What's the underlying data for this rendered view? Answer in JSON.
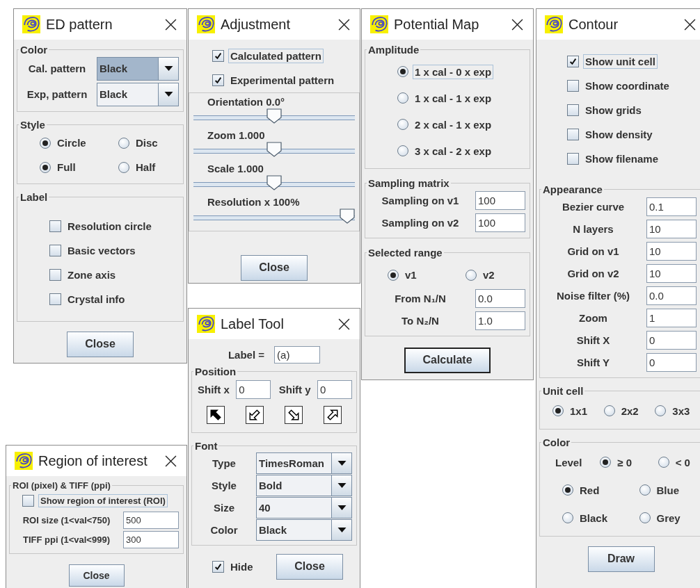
{
  "windows": [
    {
      "title": "ED pattern",
      "sections": [
        {
          "framed": true,
          "title": "Color",
          "rows": [
            {
              "kind": "combo",
              "label": "Cal. pattern",
              "value": "Black",
              "highlighted": true
            },
            {
              "kind": "combo",
              "label": "Exp, pattern",
              "value": "Black",
              "highlighted": false
            }
          ]
        },
        {
          "framed": true,
          "title": "Style",
          "rows": [
            {
              "kind": "radios",
              "options": [
                {
                  "label": "Circle",
                  "selected": true,
                  "focused": false
                },
                {
                  "label": "Disc",
                  "selected": false,
                  "focused": false
                }
              ]
            },
            {
              "kind": "radios",
              "options": [
                {
                  "label": "Full",
                  "selected": true,
                  "focused": false
                },
                {
                  "label": "Half",
                  "selected": false,
                  "focused": false
                }
              ]
            }
          ]
        },
        {
          "framed": true,
          "title": "Label",
          "rows": [
            {
              "kind": "checkbox",
              "label": "Resolution circle",
              "checked": false,
              "focused": false
            },
            {
              "kind": "checkbox",
              "label": "Basic vectors",
              "checked": false,
              "focused": false
            },
            {
              "kind": "checkbox",
              "label": "Zone axis",
              "checked": false,
              "focused": false
            },
            {
              "kind": "checkbox",
              "label": "Crystal info",
              "checked": false,
              "focused": false
            }
          ]
        },
        {
          "framed": false,
          "rows": [
            {
              "kind": "button",
              "label": "Close",
              "default": false
            }
          ]
        }
      ]
    },
    {
      "title": "Adjustment",
      "sections": [
        {
          "framed": false,
          "rows": [
            {
              "kind": "checkbox",
              "label": "Calculated pattern",
              "checked": true,
              "focused": true
            },
            {
              "kind": "checkbox",
              "label": "Experimental pattern",
              "checked": true,
              "focused": false
            }
          ]
        },
        {
          "framed": true,
          "rows": [
            {
              "kind": "slider",
              "label": "Orientation 0.0°",
              "level": 0.5
            },
            {
              "kind": "slider",
              "label": "Zoom 1.000",
              "level": 0.5
            },
            {
              "kind": "slider",
              "label": "Scale 1.000",
              "level": 0.5
            },
            {
              "kind": "slider",
              "label": "Resolution x 100%",
              "level": 1.0
            }
          ]
        },
        {
          "framed": false,
          "rows": [
            {
              "kind": "button",
              "label": "Close",
              "default": false
            }
          ]
        }
      ]
    },
    {
      "title": "Potential Map",
      "sections": [
        {
          "framed": true,
          "title": "Amplitude",
          "rows": [
            {
              "kind": "radios",
              "options": [
                {
                  "label": "1 x cal - 0 x exp",
                  "selected": true,
                  "focused": true
                }
              ]
            },
            {
              "kind": "radios",
              "options": [
                {
                  "label": "1 x cal - 1 x exp",
                  "selected": false,
                  "focused": false
                }
              ]
            },
            {
              "kind": "radios",
              "options": [
                {
                  "label": "2 x cal - 1 x exp",
                  "selected": false,
                  "focused": false
                }
              ]
            },
            {
              "kind": "radios",
              "options": [
                {
                  "label": "3 x cal - 2 x exp",
                  "selected": false,
                  "focused": false
                }
              ]
            }
          ]
        },
        {
          "framed": true,
          "title": "Sampling matrix",
          "rows": [
            {
              "kind": "field",
              "label": "Sampling on v1",
              "value": "100"
            },
            {
              "kind": "field",
              "label": "Sampling on v2",
              "value": "100"
            }
          ]
        },
        {
          "framed": true,
          "title": "Selected range",
          "rows": [
            {
              "kind": "radios",
              "options": [
                {
                  "label": "v1",
                  "selected": true,
                  "focused": false
                },
                {
                  "label": "v2",
                  "selected": false,
                  "focused": false
                }
              ]
            },
            {
              "kind": "field",
              "label": "From N₁/N",
              "value": "0.0"
            },
            {
              "kind": "field",
              "label": "To N₂/N",
              "value": "1.0"
            }
          ]
        },
        {
          "framed": false,
          "rows": [
            {
              "kind": "button",
              "label": "Calculate",
              "default": true
            }
          ]
        }
      ]
    },
    {
      "title": "Contour",
      "sections": [
        {
          "framed": false,
          "rows": [
            {
              "kind": "checkbox",
              "label": "Show unit cell",
              "checked": true,
              "focused": true
            },
            {
              "kind": "checkbox",
              "label": "Show coordinate",
              "checked": false,
              "focused": false
            },
            {
              "kind": "checkbox",
              "label": "Show grids",
              "checked": false,
              "focused": false
            },
            {
              "kind": "checkbox",
              "label": "Show density",
              "checked": false,
              "focused": false
            },
            {
              "kind": "checkbox",
              "label": "Show filename",
              "checked": false,
              "focused": false
            }
          ]
        },
        {
          "framed": true,
          "title": "Appearance",
          "rows": [
            {
              "kind": "field",
              "label": "Bezier curve",
              "value": "0.1"
            },
            {
              "kind": "field",
              "label": "N layers",
              "value": "10"
            },
            {
              "kind": "field",
              "label": "Grid on v1",
              "value": "10"
            },
            {
              "kind": "field",
              "label": "Grid on v2",
              "value": "10"
            },
            {
              "kind": "field",
              "label": "Noise filter (%)",
              "value": "0.0"
            },
            {
              "kind": "field",
              "label": "Zoom",
              "value": "1"
            },
            {
              "kind": "field",
              "label": "Shift X",
              "value": "0"
            },
            {
              "kind": "field",
              "label": "Shift Y",
              "value": "0"
            }
          ]
        },
        {
          "framed": true,
          "title": "Unit cell",
          "rows": [
            {
              "kind": "radios",
              "options": [
                {
                  "label": "1x1",
                  "selected": true,
                  "focused": false
                },
                {
                  "label": "2x2",
                  "selected": false,
                  "focused": false
                },
                {
                  "label": "3x3",
                  "selected": false,
                  "focused": false
                }
              ]
            }
          ]
        },
        {
          "framed": true,
          "title": "Color",
          "rows": [
            {
              "kind": "radios",
              "label": "Level",
              "options": [
                {
                  "label": "≥ 0",
                  "selected": true,
                  "focused": false
                },
                {
                  "label": "< 0",
                  "selected": false,
                  "focused": false
                }
              ]
            },
            {
              "kind": "radios",
              "options": [
                {
                  "label": "Red",
                  "selected": true,
                  "focused": false
                },
                {
                  "label": "Blue",
                  "selected": false,
                  "focused": false
                }
              ]
            },
            {
              "kind": "radios",
              "options": [
                {
                  "label": "Black",
                  "selected": false,
                  "focused": false
                },
                {
                  "label": "Grey",
                  "selected": false,
                  "focused": false
                }
              ]
            }
          ]
        },
        {
          "framed": false,
          "rows": [
            {
              "kind": "button",
              "label": "Draw",
              "default": false
            }
          ]
        }
      ]
    },
    {
      "title": "Label Tool",
      "sections": [
        {
          "framed": false,
          "rows": [
            {
              "kind": "field",
              "label": "Label =",
              "value": "(a)"
            }
          ]
        },
        {
          "framed": true,
          "title": "Position",
          "rows": [
            {
              "kind": "fields",
              "items": [
                {
                  "label": "Shift x",
                  "value": "0"
                },
                {
                  "label": "Shift y",
                  "value": "0"
                }
              ]
            },
            {
              "kind": "arrows",
              "items": [
                {
                  "selected": true
                },
                {
                  "selected": false
                },
                {
                  "selected": false
                },
                {
                  "selected": false
                }
              ]
            }
          ]
        },
        {
          "framed": true,
          "title": "Font",
          "rows": [
            {
              "kind": "combo",
              "label": "Type",
              "value": "TimesRoman",
              "highlighted": false
            },
            {
              "kind": "combo",
              "label": "Style",
              "value": "Bold",
              "highlighted": false
            },
            {
              "kind": "combo",
              "label": "Size",
              "value": "40",
              "highlighted": false
            },
            {
              "kind": "combo",
              "label": "Color",
              "value": "Black",
              "highlighted": false
            }
          ]
        },
        {
          "framed": false,
          "rows": [
            {
              "kind": "check-button",
              "label": "Hide",
              "checked": true,
              "focused": false,
              "button": {
                "label": "Close",
                "default": false
              }
            }
          ]
        }
      ]
    },
    {
      "title": "Region of interest",
      "sections": [
        {
          "framed": true,
          "title": "ROI (pixel) & TIFF (ppi)",
          "rows": [
            {
              "kind": "checkbox",
              "label": "Show region of interest (ROI)",
              "checked": false,
              "focused": true
            },
            {
              "kind": "field",
              "label": "ROI size (1<val<750)",
              "value": "500"
            },
            {
              "kind": "field",
              "label": "TIFF ppi (1<val<999)",
              "value": "300"
            }
          ]
        },
        {
          "framed": false,
          "rows": [
            {
              "kind": "button",
              "label": "Close",
              "default": false
            }
          ]
        }
      ]
    }
  ]
}
